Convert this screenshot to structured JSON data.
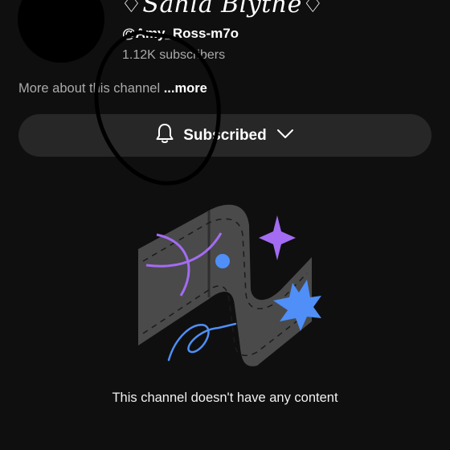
{
  "channel": {
    "name": "♢Sahla Blythe♢",
    "handle": "@Amy_Ross-m7o",
    "subscribers": "1.12K subscribers"
  },
  "about": {
    "text": "More about this channel ",
    "more_label": "...more"
  },
  "subscribe_button": {
    "label": "Subscribed",
    "icon": "bell-icon",
    "dropdown_icon": "chevron-down-icon"
  },
  "empty_state": {
    "message": "This channel doesn't have any content"
  },
  "colors": {
    "background": "#0f0f0f",
    "button_bg": "#272727",
    "secondary_text": "#aaaaaa",
    "purple": "#a36cf2",
    "blue": "#4f8ff7"
  }
}
